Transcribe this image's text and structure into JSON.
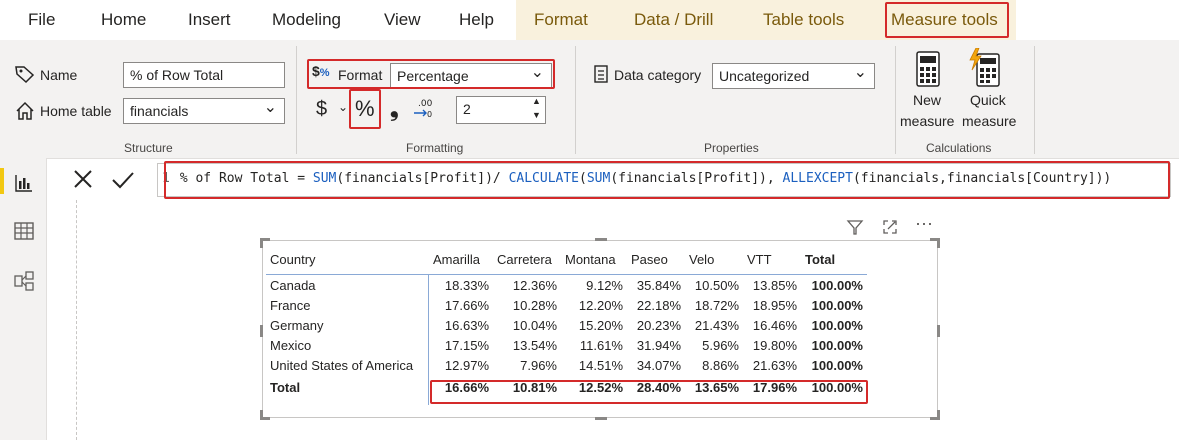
{
  "menu": {
    "items": [
      "File",
      "Home",
      "Insert",
      "Modeling",
      "View",
      "Help"
    ],
    "contextual": [
      "Format",
      "Data / Drill",
      "Table tools",
      "Measure tools"
    ]
  },
  "structure": {
    "name_label": "Name",
    "name_value": "% of Row Total",
    "home_table_label": "Home table",
    "home_table_value": "financials",
    "group_label": "Structure"
  },
  "formatting": {
    "format_label": "Format",
    "format_value": "Percentage",
    "currency_symbol": "$",
    "percent_symbol": "%",
    "comma_symbol": "❟",
    "decimals_value": "2",
    "group_label": "Formatting"
  },
  "properties": {
    "data_category_label": "Data category",
    "data_category_value": "Uncategorized",
    "group_label": "Properties"
  },
  "calculations": {
    "new_measure_line1": "New",
    "new_measure_line2": "measure",
    "quick_measure_line1": "Quick",
    "quick_measure_line2": "measure",
    "group_label": "Calculations"
  },
  "formula": {
    "line_number": "1",
    "p1": "% of Row Total = ",
    "f1": "SUM",
    "p2": "(financials[Profit])/ ",
    "f2": "CALCULATE",
    "p3": "(",
    "f3": "SUM",
    "p4": "(financials[Profit]), ",
    "f4": "ALLEXCEPT",
    "p5": "(financials,financials[Country]))"
  },
  "matrix": {
    "columns": [
      "Country",
      "Amarilla",
      "Carretera",
      "Montana",
      "Paseo",
      "Velo",
      "VTT",
      "Total"
    ],
    "rows": [
      [
        "Canada",
        "18.33%",
        "12.36%",
        "9.12%",
        "35.84%",
        "10.50%",
        "13.85%",
        "100.00%"
      ],
      [
        "France",
        "17.66%",
        "10.28%",
        "12.20%",
        "22.18%",
        "18.72%",
        "18.95%",
        "100.00%"
      ],
      [
        "Germany",
        "16.63%",
        "10.04%",
        "15.20%",
        "20.23%",
        "21.43%",
        "16.46%",
        "100.00%"
      ],
      [
        "Mexico",
        "17.15%",
        "13.54%",
        "11.61%",
        "31.94%",
        "5.96%",
        "19.80%",
        "100.00%"
      ],
      [
        "United States of America",
        "12.97%",
        "7.96%",
        "14.51%",
        "34.07%",
        "8.86%",
        "21.63%",
        "100.00%"
      ]
    ],
    "total_row": [
      "Total",
      "16.66%",
      "10.81%",
      "12.52%",
      "28.40%",
      "13.65%",
      "17.96%",
      "100.00%"
    ]
  },
  "colors": {
    "highlight": "#d42a2a",
    "accent": "#f2c811",
    "contextual_tab_text": "#7a5a0c",
    "dax_function": "#1b5fbf"
  }
}
